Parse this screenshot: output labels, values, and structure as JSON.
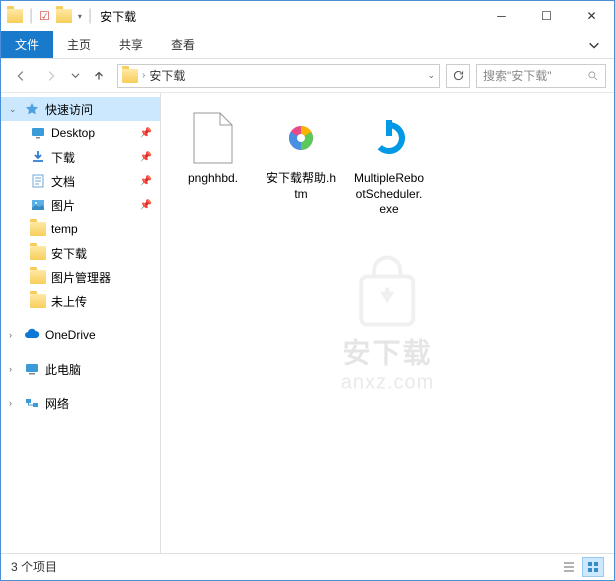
{
  "titlebar": {
    "title": "安下载"
  },
  "ribbon": {
    "file": "文件",
    "tabs": [
      "主页",
      "共享",
      "查看"
    ]
  },
  "breadcrumb": {
    "item": "安下载"
  },
  "search": {
    "placeholder": "搜索\"安下载\""
  },
  "sidebar": {
    "quickAccess": "快速访问",
    "items": [
      {
        "label": "Desktop"
      },
      {
        "label": "下载"
      },
      {
        "label": "文档"
      },
      {
        "label": "图片"
      },
      {
        "label": "temp"
      },
      {
        "label": "安下载"
      },
      {
        "label": "图片管理器"
      },
      {
        "label": "未上传"
      }
    ],
    "onedrive": "OneDrive",
    "thispc": "此电脑",
    "network": "网络"
  },
  "files": [
    {
      "name": "pnghhbd."
    },
    {
      "name": "安下载帮助.htm"
    },
    {
      "name": "MultipleRebootScheduler.exe"
    }
  ],
  "status": {
    "count": "3 个项目"
  },
  "watermark": {
    "text": "安下载",
    "sub": "anxz.com"
  }
}
